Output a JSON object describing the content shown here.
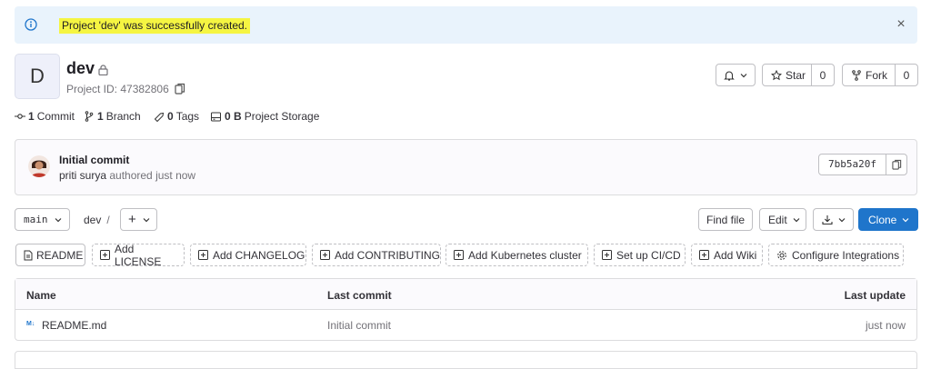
{
  "alert": {
    "message": "Project 'dev' was successfully created.",
    "close_symbol": "×"
  },
  "project": {
    "avatar_letter": "D",
    "name": "dev",
    "id_text": "Project ID: 47382806"
  },
  "actions": {
    "star_label": "Star",
    "star_count": "0",
    "fork_label": "Fork",
    "fork_count": "0"
  },
  "stats": {
    "commits_count": "1",
    "commits_label": "Commit",
    "branches_count": "1",
    "branches_label": "Branch",
    "tags_count": "0",
    "tags_label": "Tags",
    "storage_count": "0 B",
    "storage_label": "Project Storage"
  },
  "last_commit": {
    "title": "Initial commit",
    "author": "priti surya",
    "action": "authored just now",
    "sha": "7bb5a20f"
  },
  "repo_nav": {
    "branch": "main",
    "path": "dev",
    "path_separator": "/",
    "add_symbol": "+",
    "find_file": "Find file",
    "edit": "Edit",
    "clone": "Clone"
  },
  "quick_actions": [
    "README",
    "Add LICENSE",
    "Add CHANGELOG",
    "Add CONTRIBUTING",
    "Add Kubernetes cluster",
    "Set up CI/CD",
    "Add Wiki",
    "Configure Integrations"
  ],
  "file_table": {
    "headers": {
      "name": "Name",
      "last_commit": "Last commit",
      "last_update": "Last update"
    },
    "rows": [
      {
        "icon": "markdown-file-icon",
        "icon_text": "M↓",
        "name": "README.md",
        "last_commit": "Initial commit",
        "last_update": "just now"
      }
    ]
  },
  "colors": {
    "alert_bg": "#e9f3fc",
    "highlight": "#f5f542",
    "primary": "#1f75cb"
  }
}
